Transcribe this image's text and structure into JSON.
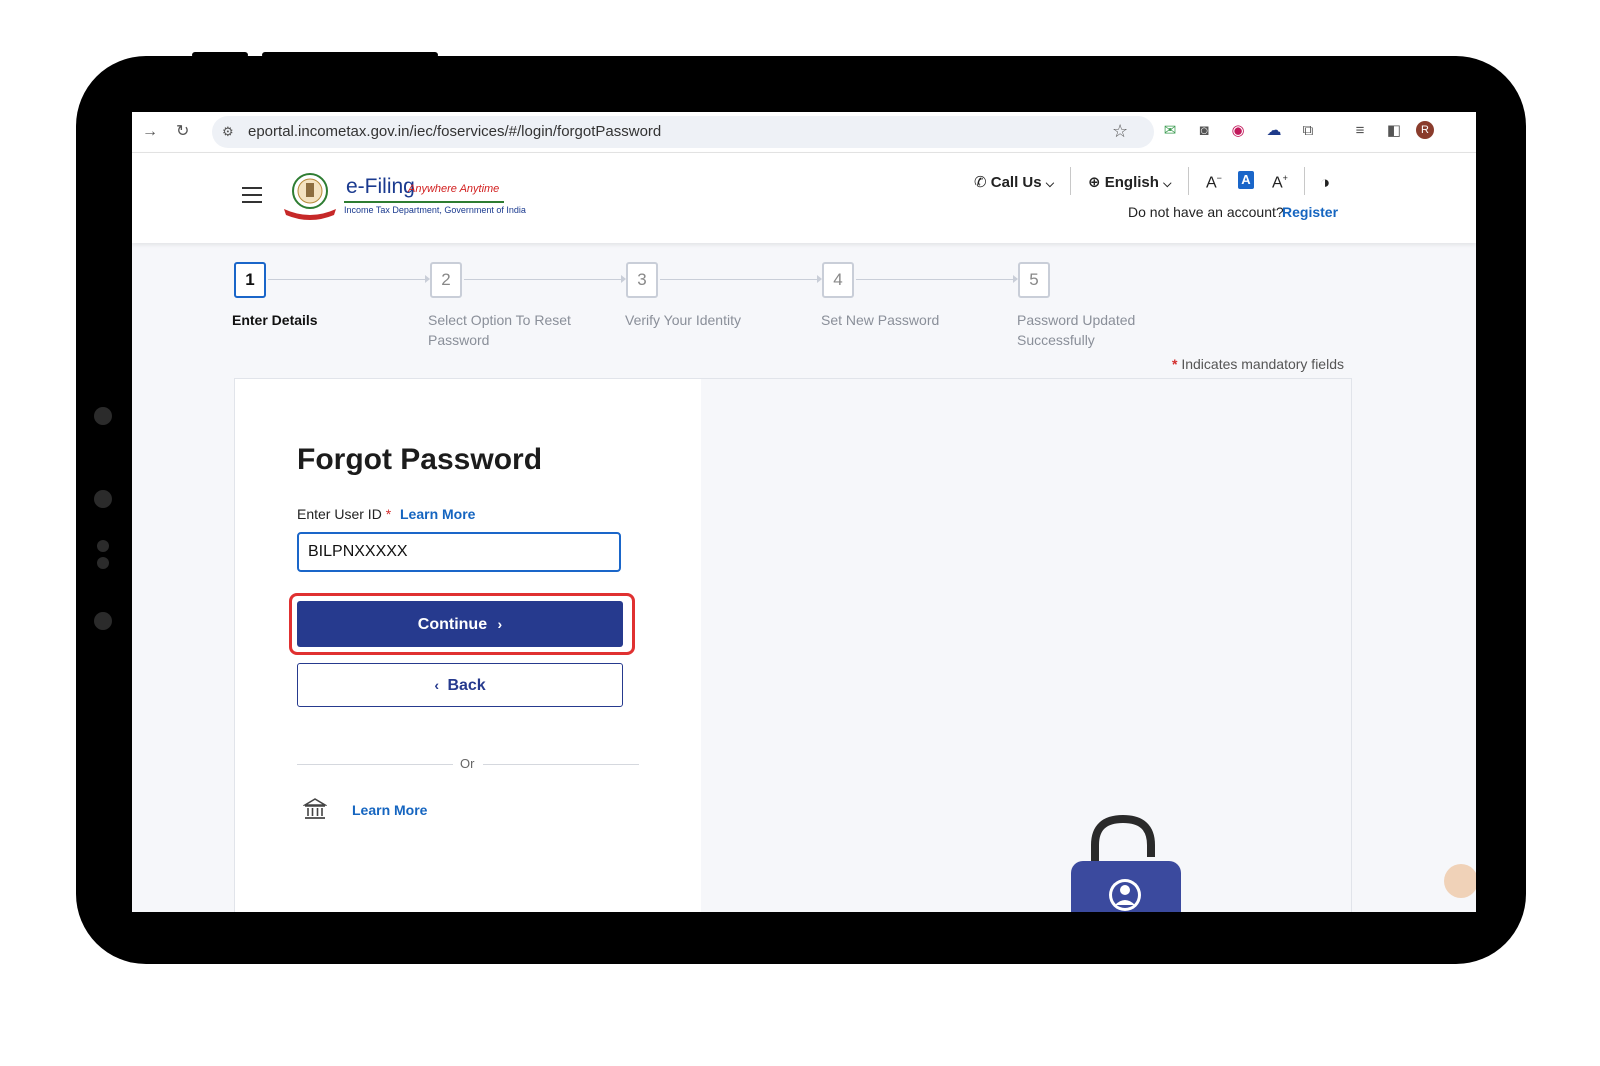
{
  "browser": {
    "url": "eportal.incometax.gov.in/iec/foservices/#/login/forgotPassword",
    "profile_initial": "R"
  },
  "header": {
    "logo_title": "e-Filing",
    "logo_tagline": "Anywhere Anytime",
    "logo_subtitle": "Income Tax Department, Government of India",
    "call_us": "Call Us",
    "language": "English",
    "font_decrease": "A",
    "font_normal": "A",
    "font_increase": "A",
    "no_account_text": "Do not have an account?",
    "register_label": "Register"
  },
  "stepper": {
    "steps": [
      {
        "number": "1",
        "label": "Enter Details"
      },
      {
        "number": "2",
        "label": "Select Option To Reset Password"
      },
      {
        "number": "3",
        "label": "Verify Your Identity"
      },
      {
        "number": "4",
        "label": "Set New Password"
      },
      {
        "number": "5",
        "label": "Password Updated Successfully"
      }
    ],
    "active_step": 1
  },
  "mandatory_note": "Indicates mandatory fields",
  "mandatory_marker": "*",
  "form": {
    "title": "Forgot Password",
    "user_id_label": "Enter User ID",
    "required_marker": "*",
    "learn_more_label": "Learn More",
    "user_id_value": "BILPNXXXXX",
    "continue_label": "Continue",
    "back_label": "Back",
    "or_label": "Or",
    "bank_learn_more_label": "Learn More"
  },
  "illustration": {
    "password_mask": "******"
  },
  "colors": {
    "primary": "#263a8e",
    "link": "#1565c0",
    "highlight": "#e03131",
    "required": "#d32f2f"
  }
}
